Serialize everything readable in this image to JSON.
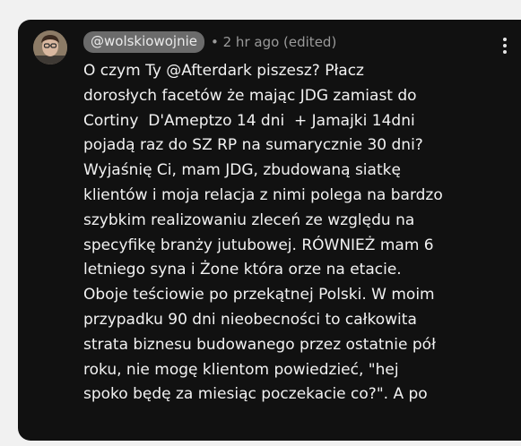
{
  "comment": {
    "author_handle": "@wolskiowojnie",
    "separator": "•",
    "meta": "2 hr ago (edited)",
    "avatar": "author-avatar",
    "more_icon": "more-vert-icon",
    "lines": [
      "O czym Ty @Afterdark piszesz? Płacz",
      "dorosłych facetów że mając JDG zamiast do",
      "Cortiny  D'Ameptzo 14 dni  + Jamajki 14dni",
      "pojadą raz do SZ RP na sumarycznie 30 dni?",
      "Wyjaśnię Ci, mam JDG, zbudowaną siatkę",
      "klientów i moja relacja z nimi polega na bardzo",
      "szybkim realizowaniu zleceń ze względu na",
      "specyfikę branży jutubowej. RÓWNIEŻ mam 6",
      "letniego syna i Żone która orze na etacie.",
      "Oboje teściowie po przekątnej Polski. W moim",
      "przypadku 90 dni nieobecności to całkowita",
      "strata biznesu budowanego przez ostatnie pół",
      "roku, nie mogę klientom powiedzieć, \"hej",
      "spoko będę za miesiąc poczekacie co?\". A po"
    ]
  }
}
